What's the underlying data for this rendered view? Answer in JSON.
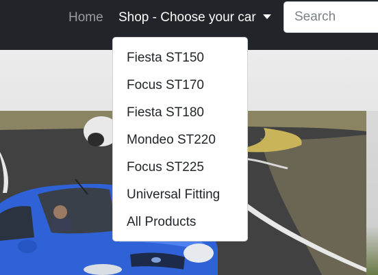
{
  "navbar": {
    "home_label": "Home",
    "shop_label": "Shop - Choose your car",
    "search_placeholder": "Search",
    "search_value": ""
  },
  "dropdown": {
    "items": [
      {
        "label": "Fiesta ST150"
      },
      {
        "label": "Focus ST170"
      },
      {
        "label": "Fiesta ST180"
      },
      {
        "label": "Mondeo ST220"
      },
      {
        "label": "Focus ST225"
      },
      {
        "label": "Universal Fitting"
      },
      {
        "label": "All Products"
      }
    ]
  },
  "colors": {
    "navbar_bg": "#212529",
    "nav_inactive": "#9a9da1",
    "nav_active": "#ffffff",
    "car_blue": "#2f62d6"
  },
  "hero": {
    "image": "car-on-track-photo"
  }
}
